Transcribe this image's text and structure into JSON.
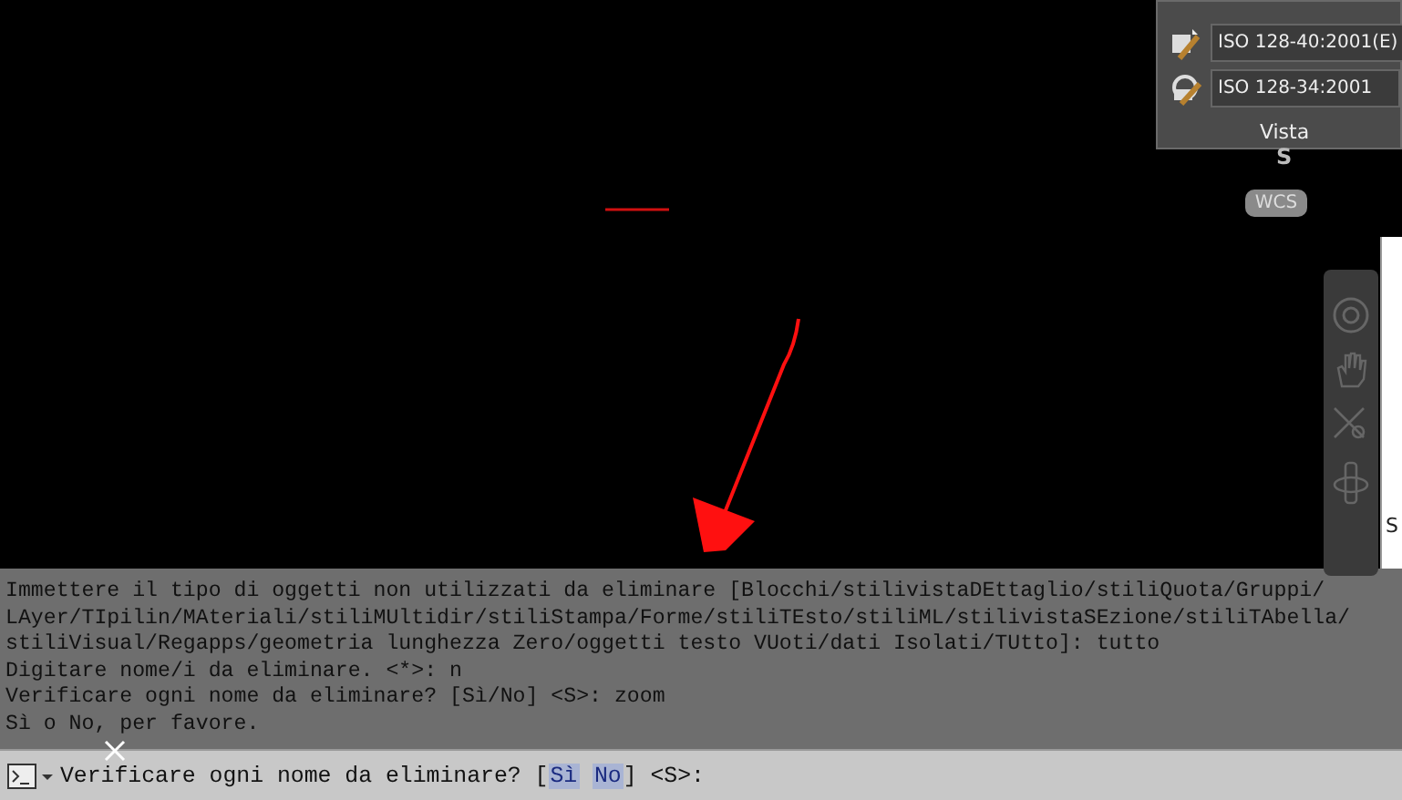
{
  "view_panel": {
    "styles": [
      {
        "kind": "dimension",
        "value": "ISO 128-40:2001(E)"
      },
      {
        "kind": "multileader",
        "value": "ISO 128-34:2001"
      }
    ],
    "title": "Vista"
  },
  "viewcube": {
    "compass": "S",
    "ucs": "WCS"
  },
  "side_panel": {
    "text": "S"
  },
  "command_history": [
    "Immettere il tipo di oggetti non utilizzati da eliminare [Blocchi/stilivistaDEttaglio/stiliQuota/Gruppi/",
    "LAyer/TIpilin/MAteriali/stiliMUltidir/stiliStampa/Forme/stiliTEsto/stiliML/stilivistaSEzione/stiliTAbella/",
    "stiliVisual/Regapps/geometria lunghezza Zero/oggetti testo VUoti/dati Isolati/TUtto]: tutto",
    "Digitare nome/i da eliminare. <*>: n",
    "Verificare ogni nome da eliminare? [Sì/No] <S>: zoom",
    "Sì o No, per favore."
  ],
  "command_line": {
    "prompt": "Verificare ogni nome da eliminare? [",
    "options": [
      "Sì",
      "No"
    ],
    "suffix": "] <S>:"
  }
}
